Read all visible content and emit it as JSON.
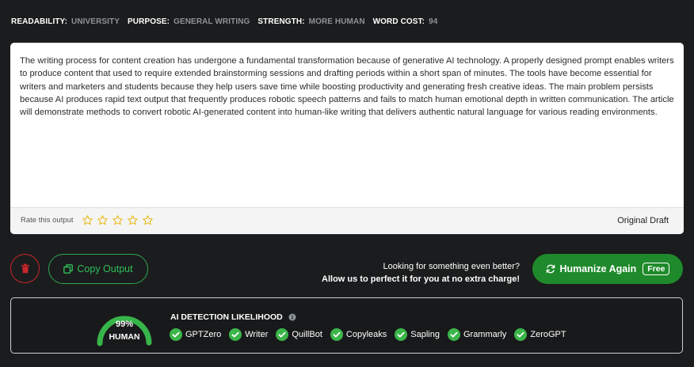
{
  "meta": [
    {
      "label": "READABILITY:",
      "value": "UNIVERSITY"
    },
    {
      "label": "PURPOSE:",
      "value": "GENERAL WRITING"
    },
    {
      "label": "STRENGTH:",
      "value": "MORE HUMAN"
    },
    {
      "label": "WORD COST:",
      "value": "94"
    }
  ],
  "output": {
    "text": "The writing process for content creation has undergone a fundamental transformation because of generative AI technology. A properly designed prompt enables writers to produce content that used to require extended brainstorming sessions and drafting periods within a short span of minutes. The tools have become essential for writers and marketers and students because they help users save time while boosting productivity and generating fresh creative ideas. The main problem persists because AI produces rapid text output that frequently produces robotic speech patterns and fails to match human emotional depth in written communication. The article will demonstrate methods to convert robotic AI-generated content into human-like writing that delivers authentic natural language for various reading environments.",
    "rate_label": "Rate this output",
    "rating": 0,
    "max_rating": 5,
    "draft_label": "Original Draft"
  },
  "actions": {
    "copy_label": "Copy Output",
    "promo_line1": "Looking for something even better?",
    "promo_line2": "Allow us to perfect it for you at no extra charge!",
    "humanize_label": "Humanize Again",
    "free_badge": "Free"
  },
  "detection": {
    "title": "AI DETECTION LIKELIHOOD",
    "percent": "99%",
    "percent_value": 99,
    "label": "HUMAN",
    "detectors": [
      "GPTZero",
      "Writer",
      "QuillBot",
      "Copyleaks",
      "Sapling",
      "Grammarly",
      "ZeroGPT"
    ]
  },
  "colors": {
    "accent_green": "#1f8a2b",
    "check_green": "#3bb54a",
    "delete_red": "#c9272c",
    "star_gold": "#e8b60c"
  },
  "icons": {
    "delete": "trash-icon",
    "copy": "copy-icon",
    "humanize": "refresh-icon",
    "info": "info-icon",
    "check": "check-circle-icon",
    "star": "star-outline-icon"
  }
}
